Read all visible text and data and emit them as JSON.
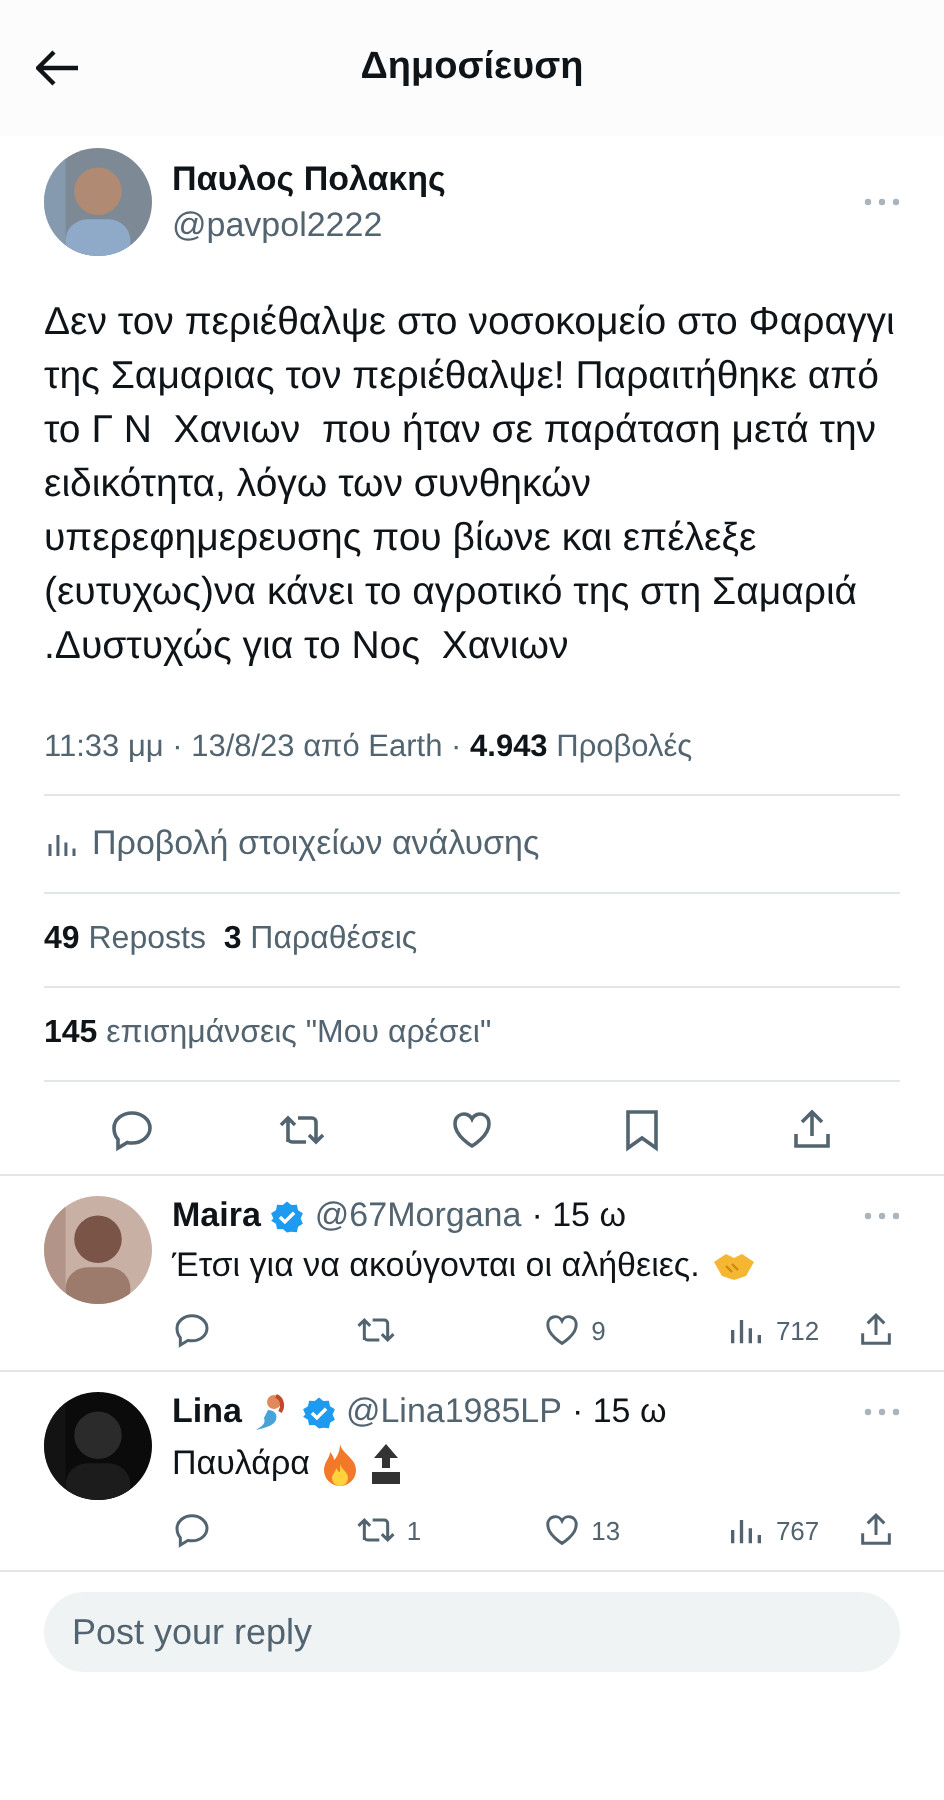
{
  "header": {
    "title": "Δημοσίευση"
  },
  "post": {
    "author": "Παυλος Πολακης",
    "handle": "@pavpol2222",
    "text": "Δεν τον περιέθαλψε στο νοσοκομείο στο Φαραγγι της Σαμαριας τον περιέθαλψε! Παραιτήθηκε από το Γ Ν  Χανιων  που ήταν σε παράταση μετά την  ειδικότητα, λόγω των συνθηκών υπερεφημερευσης που βίωνε και επέλεξε (ευτυχως)να κάνει το αγροτικό της στη Σαμαριά .Δυστυχώς για το Νος  Χανιων",
    "meta": "11:33 μμ · 13/8/23 από Earth · **4.943** Προβολές",
    "analytics": "Προβολή στοιχείων ανάλυσης",
    "reposts": "**49** Reposts  **3** Παραθέσεις",
    "likes": "**145** επισημάνσεις \"Μου αρέσει\""
  },
  "replies": [
    {
      "name": "Maira",
      "verified": true,
      "handle": "@67Morgana",
      "time": "· 15 ω",
      "text": "Έτσι για να ακούγονται οι αλήθειες.",
      "likes": "9",
      "views": "712"
    },
    {
      "name": "Lina",
      "verified": true,
      "handle": "@Lina1985LP",
      "time": "· 15 ω",
      "text": "Παυλάρα",
      "reposts": "1",
      "likes": "13",
      "views": "767"
    }
  ],
  "reply_box": {
    "placeholder": "Post your reply"
  }
}
